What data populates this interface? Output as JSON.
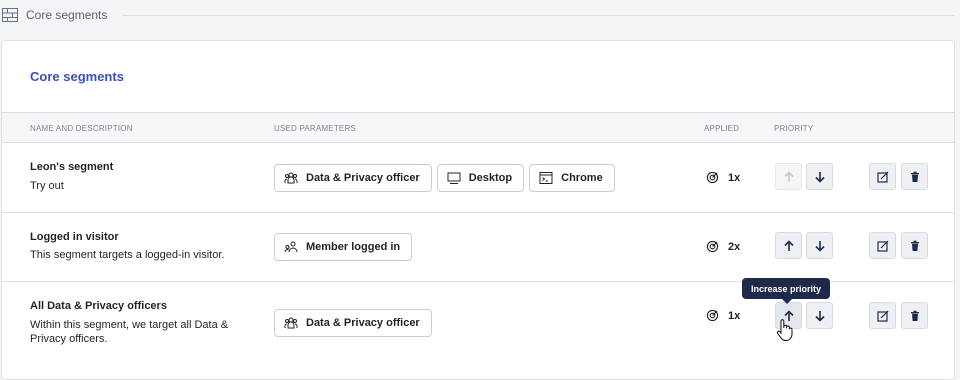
{
  "section": {
    "title": "Core segments",
    "icon": "segments-icon"
  },
  "card": {
    "title": "Core segments"
  },
  "table": {
    "headers": {
      "name": "NAME AND DESCRIPTION",
      "params": "USED PARAMETERS",
      "applied": "APPLIED",
      "priority": "PRIORITY"
    },
    "rows": [
      {
        "name": "Leon's segment",
        "description": "Try out",
        "parameters": [
          {
            "label": "Data & Privacy officer",
            "icon": "people-icon"
          },
          {
            "label": "Desktop",
            "icon": "desktop-icon"
          },
          {
            "label": "Chrome",
            "icon": "browser-icon"
          }
        ],
        "applied": "1x",
        "increase_disabled": true
      },
      {
        "name": "Logged in visitor",
        "description": "This segment targets a logged-in visitor.",
        "parameters": [
          {
            "label": "Member logged in",
            "icon": "member-icon"
          }
        ],
        "applied": "2x",
        "increase_disabled": false
      },
      {
        "name": "All Data & Privacy officers",
        "description": "Within this segment, we target all Data & Privacy officers.",
        "parameters": [
          {
            "label": "Data & Privacy officer",
            "icon": "people-icon"
          }
        ],
        "applied": "1x",
        "increase_disabled": false
      }
    ]
  },
  "tooltip": {
    "text": "Increase priority"
  },
  "colors": {
    "accent": "#3b50b8",
    "tooltip_bg": "#1f2a4a",
    "border": "#dde1e6"
  }
}
